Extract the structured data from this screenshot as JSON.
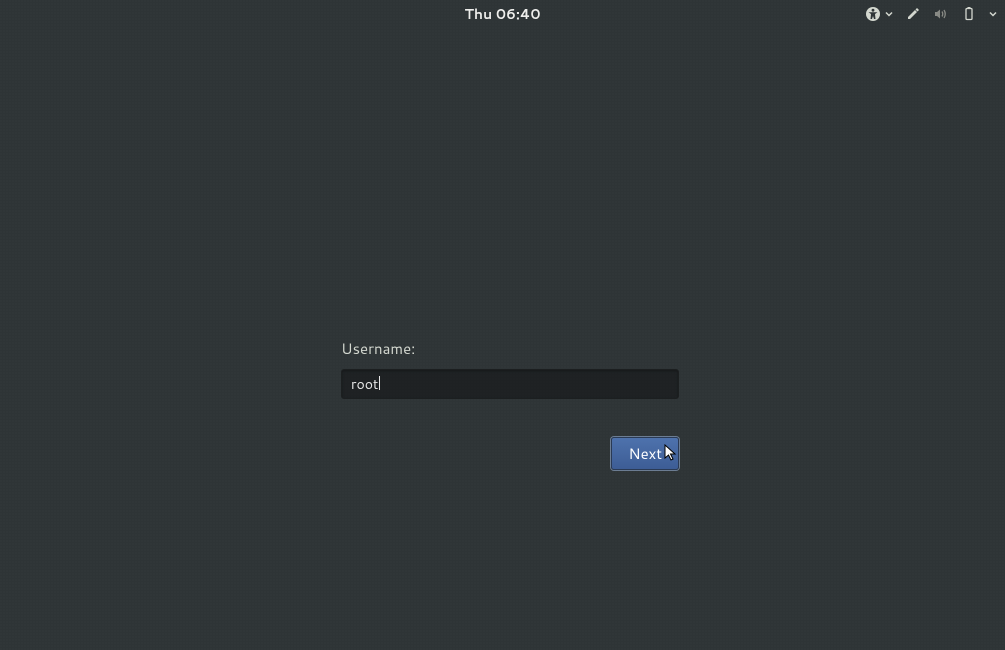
{
  "topbar": {
    "clock": "Thu 06:40"
  },
  "tray": {
    "accessibility_icon": "accessibility-icon",
    "dropper_icon": "color-picker-icon",
    "volume_icon": "volume-icon",
    "battery_icon": "battery-icon"
  },
  "login": {
    "username_label": "Username:",
    "username_value": "root",
    "next_label": "Next"
  }
}
